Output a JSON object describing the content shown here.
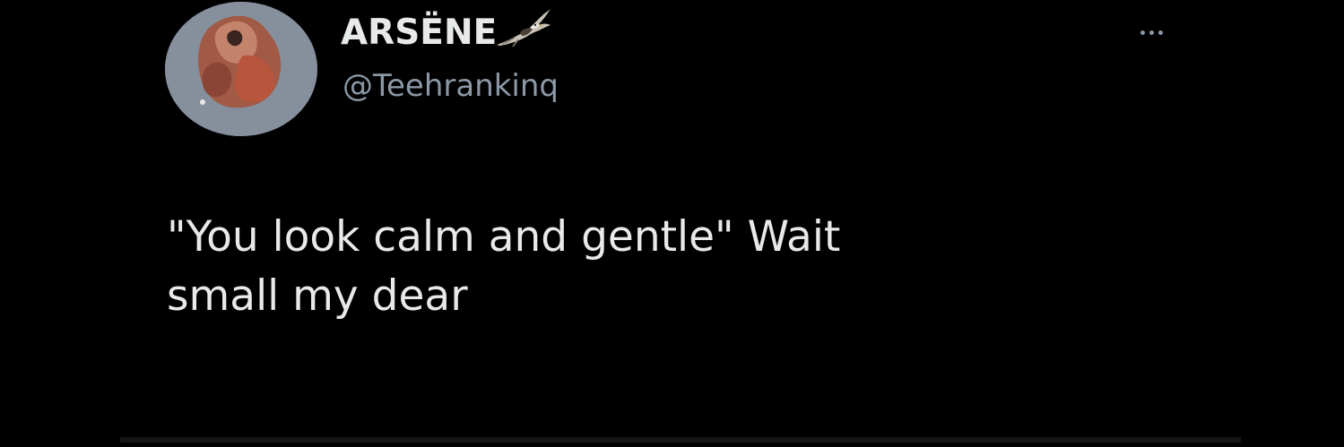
{
  "author": {
    "display_name": "ARSËNE",
    "handle": "@Teehrankinq",
    "avatar_icon": "avatar-photo",
    "name_emoji": "eagle-icon"
  },
  "menu": {
    "icon": "more-options-icon"
  },
  "tweet": {
    "text": "\"You look calm and gentle\" Wait\nsmall my dear"
  },
  "colors": {
    "background": "#000000",
    "primary_text": "#e7e9ea",
    "secondary_text": "#8b98a5",
    "avatar_bg": "#85909c"
  }
}
